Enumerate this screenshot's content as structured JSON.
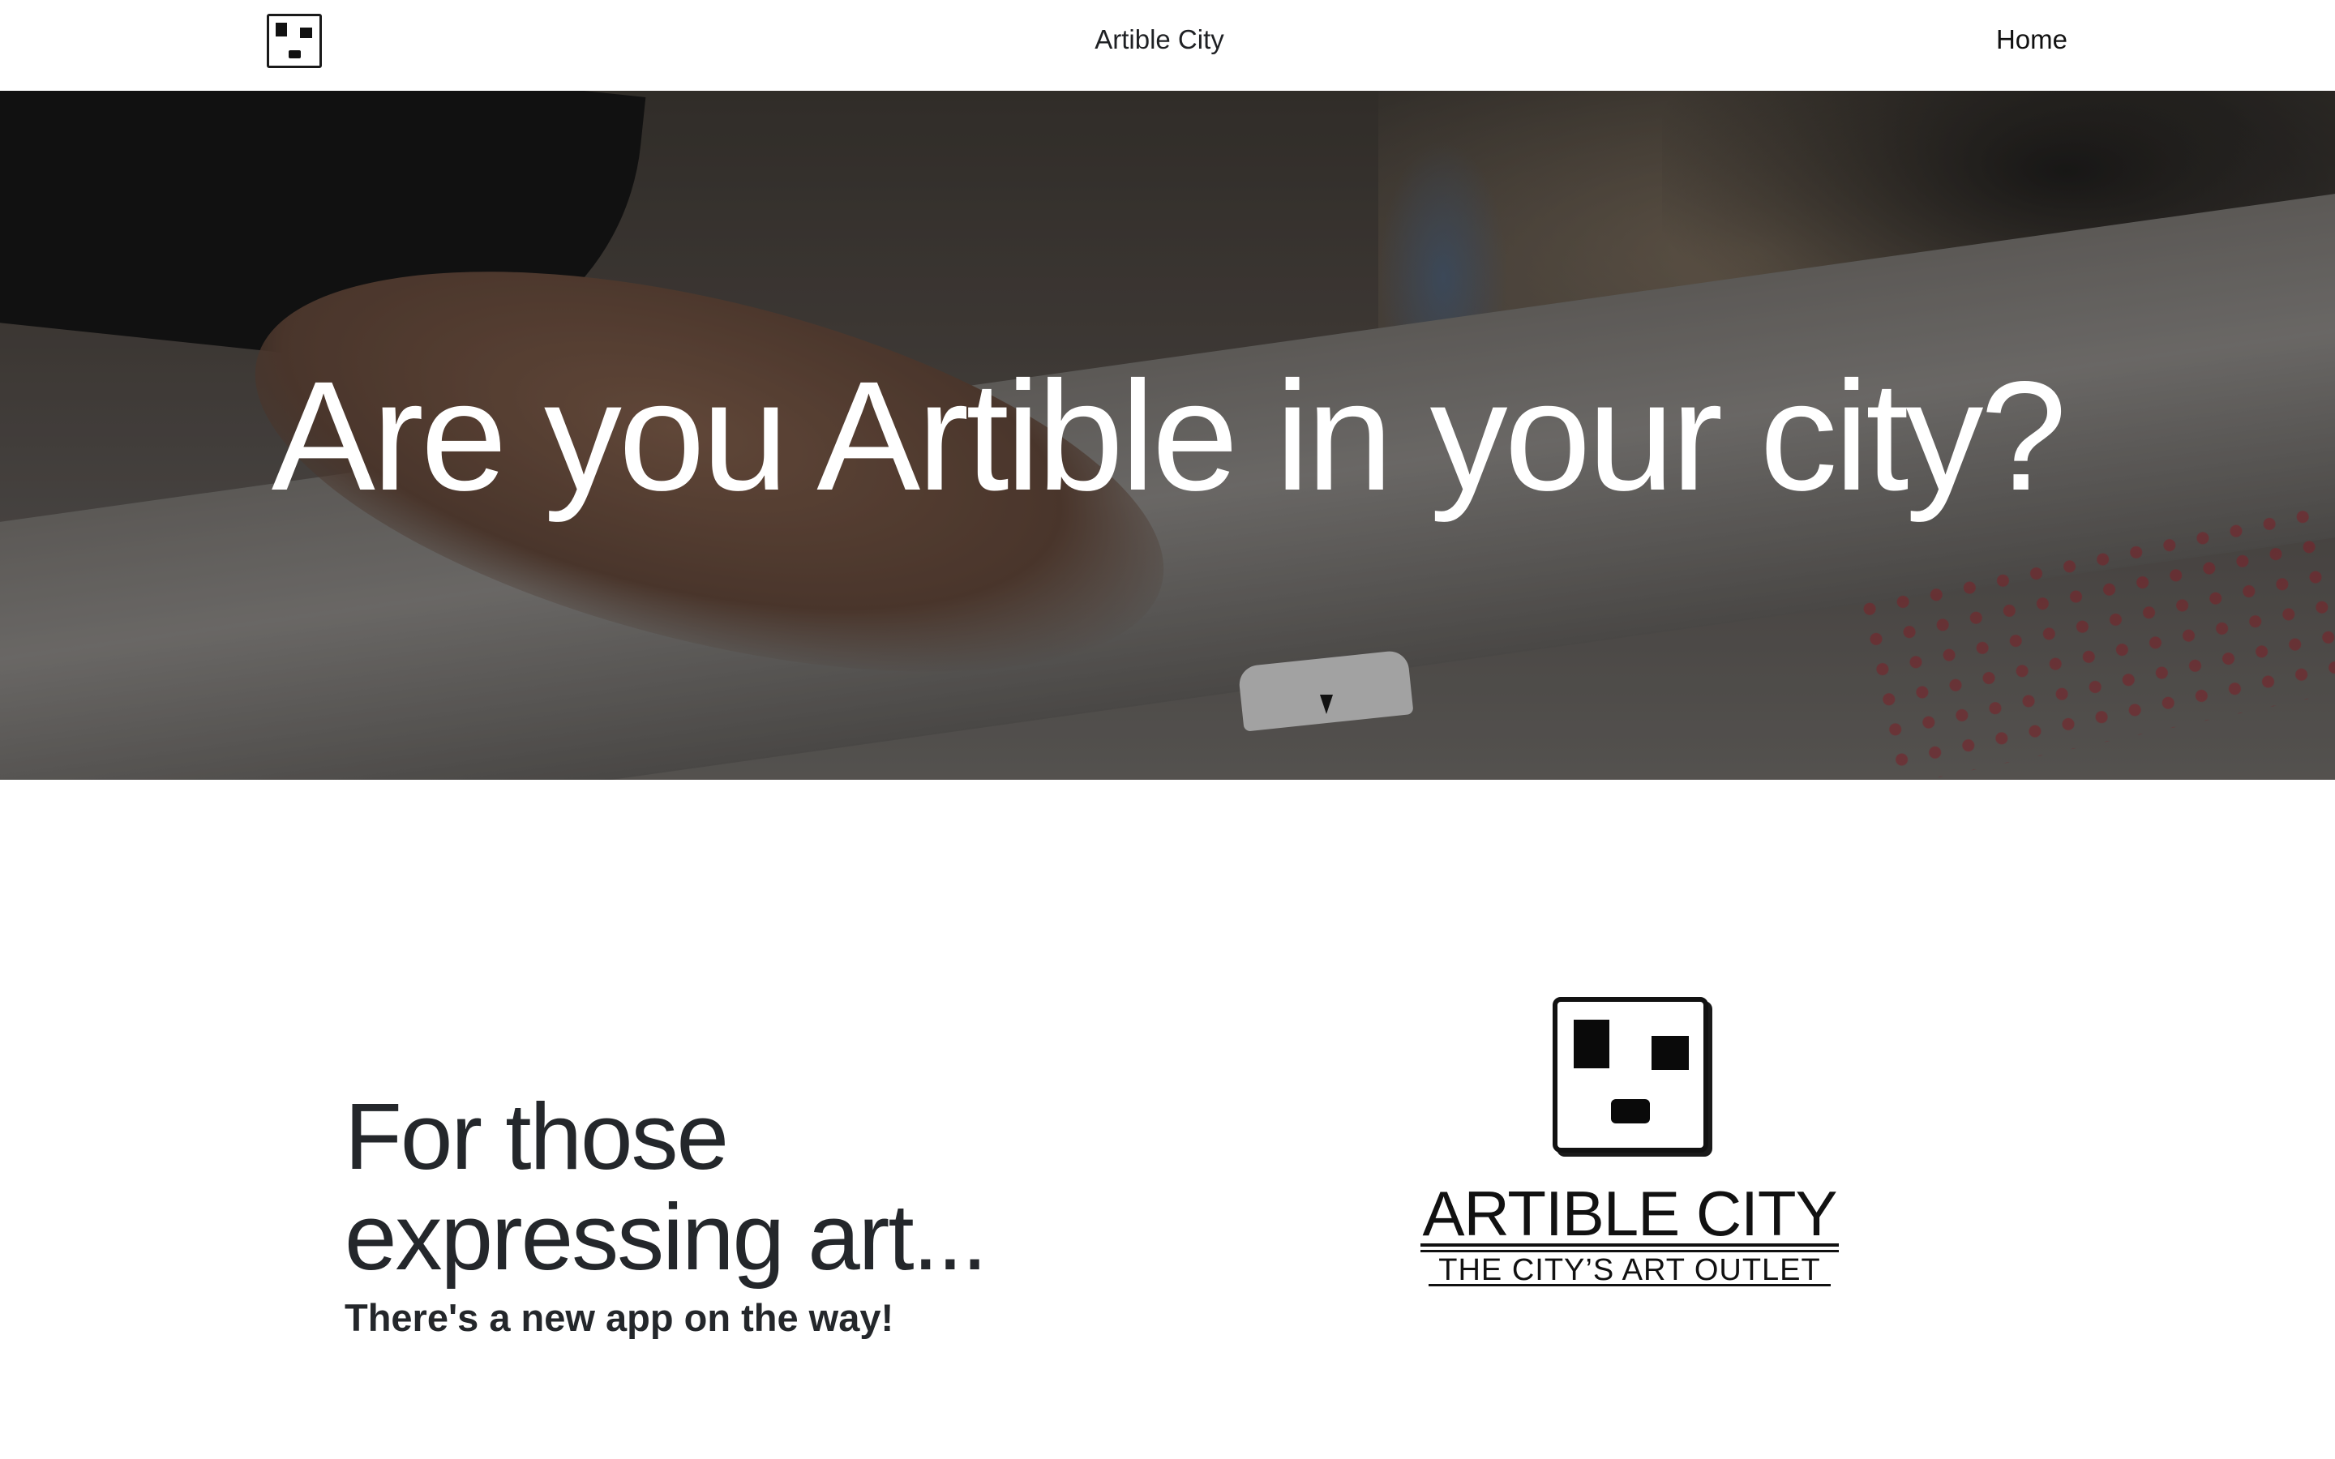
{
  "navbar": {
    "brand": "Artible City",
    "home_link": "Home"
  },
  "hero": {
    "title": "Are you Artible in your city?"
  },
  "intro": {
    "tagline": "For those expressing art...",
    "subtext": "There's a new app on the way!"
  },
  "brand_logo": {
    "name": "ARTIBLE CITY",
    "motto": "THE CITY’S ART OUTLET"
  }
}
